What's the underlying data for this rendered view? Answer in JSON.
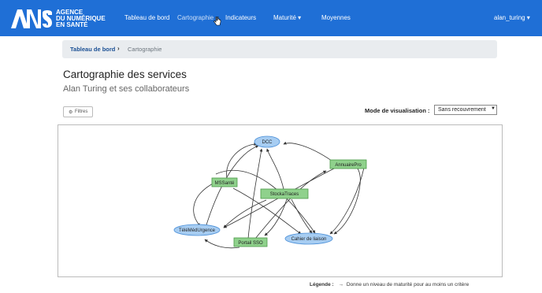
{
  "brand": {
    "name_lines": [
      "AGENCE",
      "DU NUMÉRIQUE",
      "EN SANTÉ"
    ],
    "logo_icon": "ans-logo",
    "color": "#1f6fd6"
  },
  "nav": {
    "items": [
      {
        "label": "Tableau de bord"
      },
      {
        "label": "Cartographie"
      },
      {
        "label": "Indicateurs"
      },
      {
        "label": "Maturité ▾"
      },
      {
        "label": "Moyennes"
      }
    ],
    "user": "alan_turing ▾"
  },
  "breadcrumb": {
    "home": "Tableau de bord",
    "separator": "›",
    "current": "Cartographie"
  },
  "page": {
    "title": "Cartographie des services",
    "subtitle": "Alan Turing et ses collaborateurs"
  },
  "filters": {
    "icon": "gear-icon",
    "label": "Filtres"
  },
  "visualization": {
    "label": "Mode de visualisation :",
    "selected": "Sans recouvrement"
  },
  "graph": {
    "colors": {
      "blue_node": "#a7cdf2",
      "blue_border": "#4a8fd8",
      "green_node": "#8fd18c",
      "green_border": "#4a9a48"
    },
    "nodes": [
      {
        "id": "dcc",
        "label": "DCC",
        "type": "blue"
      },
      {
        "id": "annuaire",
        "label": "AnnuairePro",
        "type": "green"
      },
      {
        "id": "mss",
        "label": "MSSanté",
        "type": "green"
      },
      {
        "id": "stocka",
        "label": "StockaTraces",
        "type": "green"
      },
      {
        "id": "tele",
        "label": "TéléMédUrgence",
        "type": "blue"
      },
      {
        "id": "portail",
        "label": "Portail SSO",
        "type": "green"
      },
      {
        "id": "cahier",
        "label": "Cahier de liaison",
        "type": "blue"
      }
    ]
  },
  "legend": {
    "title": "Légende :",
    "arrow": "→",
    "text": "Donne un niveau de maturité pour au moins un critère"
  }
}
